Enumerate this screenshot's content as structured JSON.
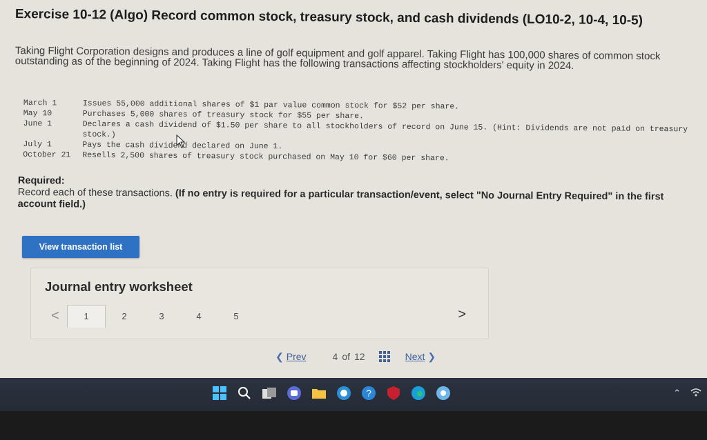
{
  "title": "Exercise 10-12 (Algo) Record common stock, treasury stock, and cash dividends (LO10-2, 10-4, 10-5)",
  "intro": "Taking Flight Corporation designs and produces a line of golf equipment and golf apparel. Taking Flight has 100,000 shares of common stock outstanding as of the beginning of 2024. Taking Flight has the following transactions affecting stockholders' equity in 2024.",
  "transactions": [
    {
      "date": "March 1",
      "desc": "Issues 55,000 additional shares of $1 par value common stock for $52 per share."
    },
    {
      "date": "May 10",
      "desc": "Purchases 5,000 shares of treasury stock for $55 per share."
    },
    {
      "date": "June 1",
      "desc": "Declares a cash dividend of $1.50 per share to all stockholders of record on June 15. (Hint: Dividends are not paid on treasury stock.)"
    },
    {
      "date": "July 1",
      "desc": "Pays the cash dividend declared on June 1."
    },
    {
      "date": "October 21",
      "desc": "Resells 2,500 shares of treasury stock purchased on May 10 for $60 per share."
    }
  ],
  "required": {
    "heading": "Required:",
    "text": "Record each of these transactions.",
    "note": "(If no entry is required for a particular transaction/event, select \"No Journal Entry Required\" in the first account field.)"
  },
  "view_button": "View transaction list",
  "worksheet": {
    "title": "Journal entry worksheet",
    "prev_arrow": "<",
    "next_arrow": ">",
    "tabs": [
      "1",
      "2",
      "3",
      "4",
      "5"
    ],
    "active_tab": "1"
  },
  "pager": {
    "prev": "Prev",
    "position": "4",
    "of": "of",
    "total": "12",
    "next": "Next"
  },
  "taskbar": {
    "icons": [
      "windows-icon",
      "search-icon",
      "file-explorer-icon",
      "chat-icon",
      "folder-icon",
      "photos-icon",
      "help-icon",
      "mcafee-icon",
      "edge-icon",
      "app-icon"
    ]
  },
  "colors": {
    "accent": "#2f72c4",
    "page_bg": "#e6e3dd",
    "taskbar_bg": "#2b3340"
  }
}
